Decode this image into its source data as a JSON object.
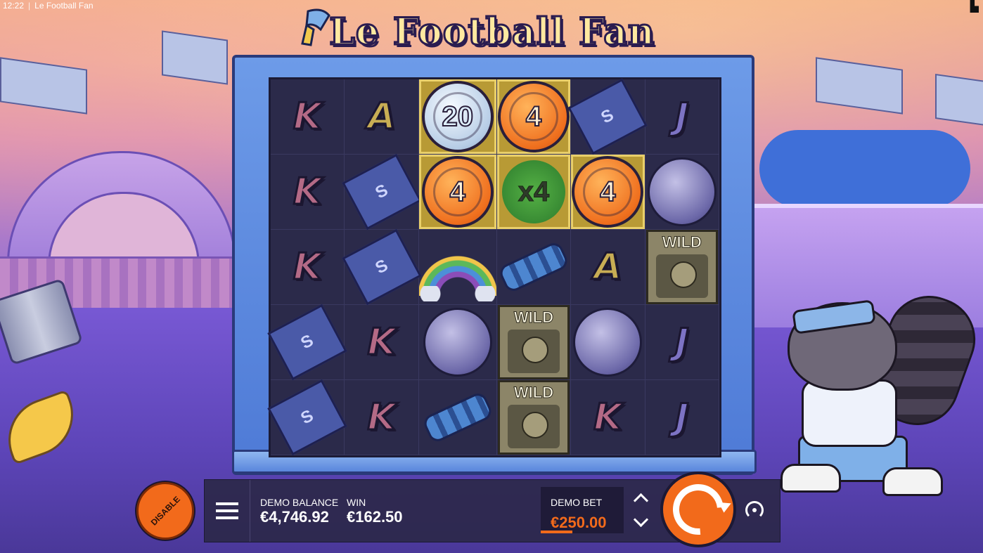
{
  "status": {
    "time": "12:22",
    "separator": "|",
    "title": "Le Football Fan"
  },
  "game": {
    "title": "Le Football Fan"
  },
  "reels": [
    [
      {
        "t": "letter",
        "v": "K"
      },
      {
        "t": "letter",
        "v": "A"
      },
      {
        "t": "coin",
        "v": "20",
        "color": "silver",
        "hl": true
      },
      {
        "t": "coin",
        "v": "4",
        "color": "orange",
        "hl": true
      },
      {
        "t": "ticket",
        "v": "S"
      },
      {
        "t": "letter",
        "v": "J"
      }
    ],
    [
      {
        "t": "letter",
        "v": "K"
      },
      {
        "t": "ticket",
        "v": "S"
      },
      {
        "t": "coin",
        "v": "4",
        "color": "orange",
        "hl": true
      },
      {
        "t": "clover",
        "v": "x4",
        "hl": true
      },
      {
        "t": "coin",
        "v": "4",
        "color": "orange",
        "hl": true
      },
      {
        "t": "ball",
        "v": ""
      }
    ],
    [
      {
        "t": "letter",
        "v": "K"
      },
      {
        "t": "ticket",
        "v": "S"
      },
      {
        "t": "rainbow",
        "v": ""
      },
      {
        "t": "scarf",
        "v": ""
      },
      {
        "t": "letter",
        "v": "A"
      },
      {
        "t": "wild",
        "v": "WILD"
      }
    ],
    [
      {
        "t": "ticket",
        "v": "S"
      },
      {
        "t": "letter",
        "v": "K"
      },
      {
        "t": "ball",
        "v": ""
      },
      {
        "t": "wild",
        "v": "WILD"
      },
      {
        "t": "ball",
        "v": ""
      },
      {
        "t": "letter",
        "v": "J"
      }
    ],
    [
      {
        "t": "ticket",
        "v": "S"
      },
      {
        "t": "letter",
        "v": "K"
      },
      {
        "t": "scarf",
        "v": ""
      },
      {
        "t": "wild",
        "v": "WILD"
      },
      {
        "t": "letter",
        "v": "K"
      },
      {
        "t": "letter",
        "v": "J"
      }
    ]
  ],
  "controls": {
    "disable_label": "DISABLE",
    "balance_label": "DEMO BALANCE",
    "balance_value": "€4,746.92",
    "win_label": "WIN",
    "win_value": "€162.50",
    "bet_label": "DEMO BET",
    "bet_value": "€250.00"
  },
  "colors": {
    "accent": "#f26a1b",
    "panel": "#2d284b",
    "highlight": "#b89a35"
  }
}
